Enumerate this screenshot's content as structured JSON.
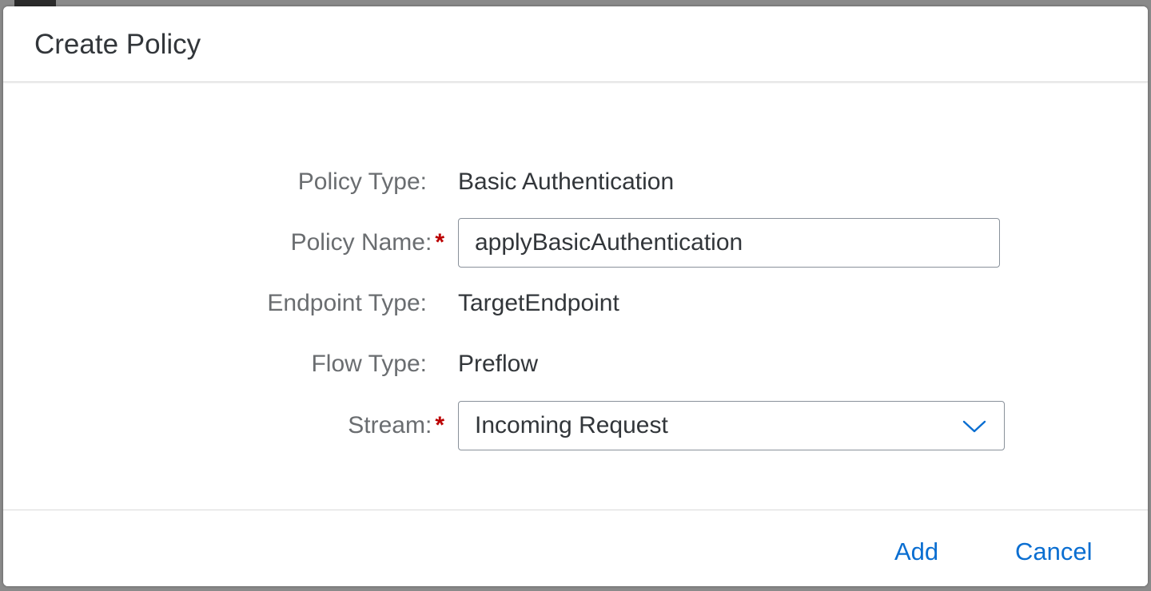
{
  "dialog": {
    "title": "Create Policy"
  },
  "form": {
    "policy_type": {
      "label": "Policy Type:",
      "value": "Basic Authentication"
    },
    "policy_name": {
      "label": "Policy Name:",
      "required_mark": "*",
      "value": "applyBasicAuthentication"
    },
    "endpoint_type": {
      "label": "Endpoint Type:",
      "value": "TargetEndpoint"
    },
    "flow_type": {
      "label": "Flow Type:",
      "value": "Preflow"
    },
    "stream": {
      "label": "Stream:",
      "required_mark": "*",
      "selected": "Incoming Request",
      "icon": "chevron-down-icon"
    }
  },
  "footer": {
    "add_label": "Add",
    "cancel_label": "Cancel"
  },
  "colors": {
    "accent": "#0a6ed1",
    "required": "#bb0000",
    "label": "#6a6d70",
    "text": "#32363a"
  }
}
